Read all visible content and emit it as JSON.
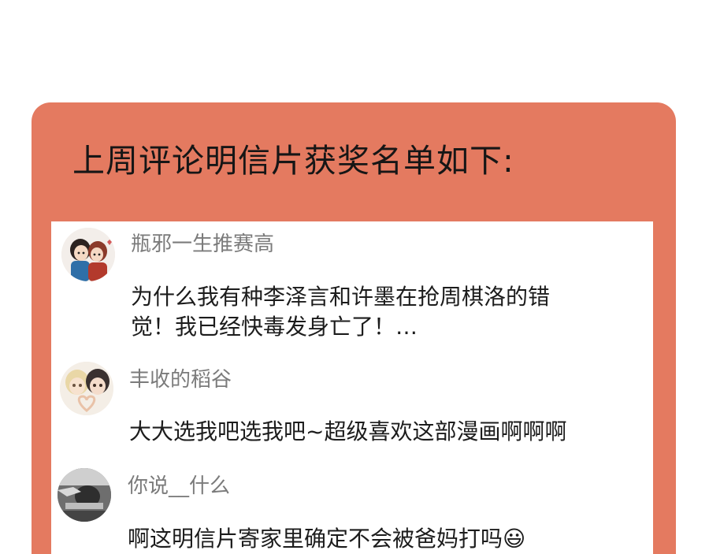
{
  "header": {
    "title": "上周评论明信片获奖名单如下:"
  },
  "comments": [
    {
      "username": "瓶邪一生推赛高",
      "lines": [
        "为什么我有种李泽言和许墨在抢周棋洛的错",
        "觉！我已经快毒发身亡了！…"
      ],
      "avatar_icon": "anime-couple-avatar"
    },
    {
      "username": "丰收的稻谷",
      "lines": [
        "大大选我吧选我吧~超级喜欢这部漫画啊啊啊"
      ],
      "avatar_icon": "anime-heart-hands-avatar"
    },
    {
      "username": "你说__什么",
      "lines": [
        "啊这明信片寄家里确定不会被爸妈打吗😃"
      ],
      "avatar_icon": "grayscale-photo-avatar"
    }
  ],
  "colors": {
    "card": "#e47a60",
    "username": "#7b7b7b",
    "text": "#1c1c1c"
  }
}
